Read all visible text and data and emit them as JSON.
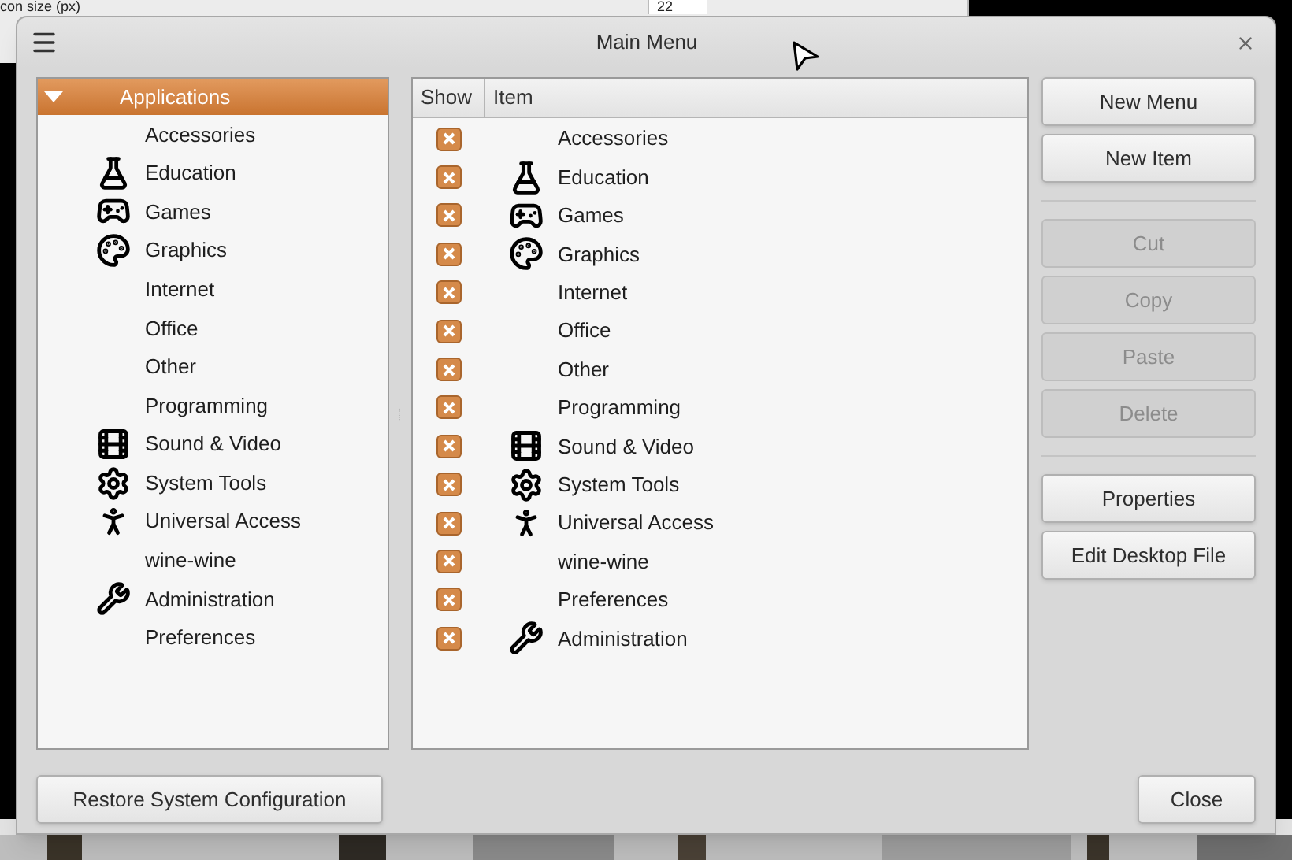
{
  "background_window": {
    "label": "con size (px)",
    "value": "22"
  },
  "window": {
    "title": "Main Menu"
  },
  "tree": {
    "root": {
      "label": "Applications",
      "expanded": true,
      "selected": true
    },
    "children": [
      {
        "label": "Accessories",
        "kind": "plain"
      },
      {
        "label": "Education",
        "kind": "flask"
      },
      {
        "label": "Games",
        "kind": "gamepad"
      },
      {
        "label": "Graphics",
        "kind": "palette"
      },
      {
        "label": "Internet",
        "kind": "plain"
      },
      {
        "label": "Office",
        "kind": "plain"
      },
      {
        "label": "Other",
        "kind": "plain"
      },
      {
        "label": "Programming",
        "kind": "plain"
      },
      {
        "label": "Sound & Video",
        "kind": "film"
      },
      {
        "label": "System Tools",
        "kind": "gear"
      },
      {
        "label": "Universal Access",
        "kind": "person"
      },
      {
        "label": "wine-wine",
        "kind": "plain"
      },
      {
        "label": "Administration",
        "kind": "tools"
      },
      {
        "label": "Preferences",
        "kind": "plain"
      }
    ]
  },
  "table": {
    "columns": [
      "Show",
      "Item"
    ],
    "rows": [
      {
        "checked": true,
        "label": "Accessories",
        "kind": "plain"
      },
      {
        "checked": true,
        "label": "Education",
        "kind": "flask"
      },
      {
        "checked": true,
        "label": "Games",
        "kind": "gamepad"
      },
      {
        "checked": true,
        "label": "Graphics",
        "kind": "palette"
      },
      {
        "checked": true,
        "label": "Internet",
        "kind": "plain"
      },
      {
        "checked": true,
        "label": "Office",
        "kind": "plain"
      },
      {
        "checked": true,
        "label": "Other",
        "kind": "plain"
      },
      {
        "checked": true,
        "label": "Programming",
        "kind": "plain"
      },
      {
        "checked": true,
        "label": "Sound & Video",
        "kind": "film"
      },
      {
        "checked": true,
        "label": "System Tools",
        "kind": "gear"
      },
      {
        "checked": true,
        "label": "Universal Access",
        "kind": "person"
      },
      {
        "checked": true,
        "label": "wine-wine",
        "kind": "plain"
      },
      {
        "checked": true,
        "label": "Preferences",
        "kind": "plain"
      },
      {
        "checked": true,
        "label": "Administration",
        "kind": "tools"
      }
    ]
  },
  "side_buttons": [
    [
      {
        "label": "New Menu",
        "disabled": false
      },
      {
        "label": "New Item",
        "disabled": false
      }
    ],
    [
      {
        "label": "Cut",
        "disabled": true
      },
      {
        "label": "Copy",
        "disabled": true
      },
      {
        "label": "Paste",
        "disabled": true
      },
      {
        "label": "Delete",
        "disabled": true
      }
    ],
    [
      {
        "label": "Properties",
        "disabled": false
      },
      {
        "label": "Edit Desktop File",
        "disabled": false
      }
    ]
  ],
  "footer": {
    "restore_button": "Restore System Configuration",
    "close_button": "Close"
  }
}
